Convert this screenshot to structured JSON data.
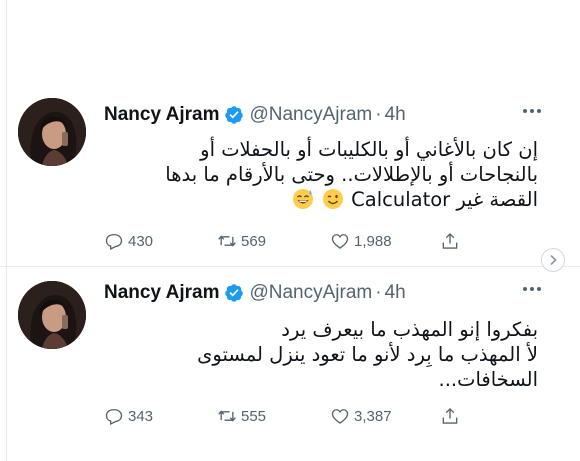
{
  "tweets": [
    {
      "author_name": "Nancy Ajram",
      "handle": "@NancyAjram",
      "separator": "·",
      "time": "4h",
      "text_lines": [
        "إن كان بالأغاني أو بالكليبات أو بالحفلات أو",
        "بالنجاحات أو بالإطلالات.. وحتى بالأرقام ما بدها",
        "القصة غير Calculator"
      ],
      "emojis": [
        "sweat-smile-emoji",
        "wink-emoji"
      ],
      "replies": "430",
      "retweets": "569",
      "likes": "1,988"
    },
    {
      "author_name": "Nancy Ajram",
      "handle": "@NancyAjram",
      "separator": "·",
      "time": "4h",
      "text_lines": [
        "بفكروا إنو المهذب ما بيعرف يرد",
        "لأ المهذب ما بِرد لأنو ما تعود ينزل لمستوى",
        "السخافات..."
      ],
      "replies": "343",
      "retweets": "555",
      "likes": "3,387"
    }
  ],
  "icons": {
    "verified": "verified-badge-icon",
    "more": "more-options-icon",
    "reply": "reply-icon",
    "retweet": "retweet-icon",
    "like": "like-icon",
    "share": "share-icon",
    "scroll_arrow": "chevron-right-icon"
  },
  "colors": {
    "verified_blue": "#1d9bf0",
    "secondary_text": "#536471",
    "primary_text": "#0f1419"
  }
}
